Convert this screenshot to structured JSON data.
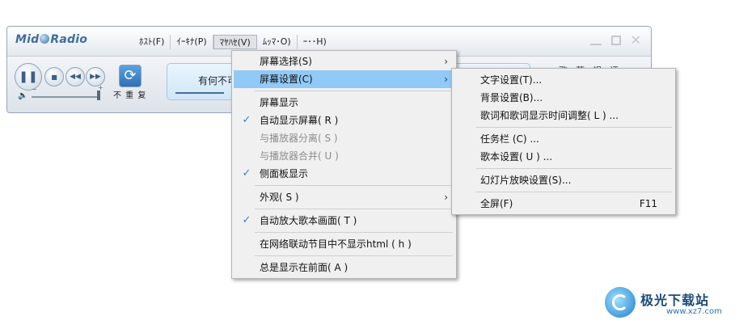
{
  "app": {
    "logo": "MidRadio",
    "menubar": [
      "ﾎｽﾄ(F)",
      "ｲｰｷﾅ(P)",
      "ﾏﾔﾊｾ(V)",
      "ﾑｯﾏ･O)",
      "ｰ･･H)"
    ],
    "window_buttons": [
      "minimize-icon",
      "maximize-icon",
      "close-icon"
    ]
  },
  "player": {
    "song": "有何不可",
    "repeat_label": "不 重 复",
    "side_labels": [
      "歌",
      "蒂",
      "视",
      "评"
    ]
  },
  "menu_main": {
    "items": [
      {
        "label": "屏幕选择(S)",
        "submenu": true,
        "checked": false,
        "disabled": false,
        "highlight": false
      },
      {
        "label": "屏幕设置(C)",
        "submenu": true,
        "checked": false,
        "disabled": false,
        "highlight": true
      },
      {
        "label": "屏幕显示",
        "submenu": false,
        "checked": false,
        "disabled": false,
        "highlight": false
      },
      {
        "label": "自动显示屏幕( R )",
        "submenu": false,
        "checked": true,
        "disabled": false,
        "highlight": false
      },
      {
        "label": "与播放器分离( S )",
        "submenu": false,
        "checked": false,
        "disabled": true,
        "highlight": false
      },
      {
        "label": "与播放器合并( U )",
        "submenu": false,
        "checked": false,
        "disabled": true,
        "highlight": false
      },
      {
        "label": "侧面板显示",
        "submenu": false,
        "checked": true,
        "disabled": false,
        "highlight": false
      },
      {
        "label": "外观( S )",
        "submenu": true,
        "checked": false,
        "disabled": false,
        "highlight": false
      },
      {
        "label": "自动放大歌本画面( T )",
        "submenu": false,
        "checked": true,
        "disabled": false,
        "highlight": false
      },
      {
        "label": "在网络联动节目中不显示html ( h )",
        "submenu": false,
        "checked": false,
        "disabled": false,
        "highlight": false
      },
      {
        "label": "总是显示在前面( A )",
        "submenu": false,
        "checked": false,
        "disabled": false,
        "highlight": false
      }
    ]
  },
  "menu_sub": {
    "items": [
      {
        "label": "文字设置(T)...",
        "shortcut": ""
      },
      {
        "label": "背景设置(B)...",
        "shortcut": ""
      },
      {
        "label": "歌词和歌词显示时间调整( L ) ...",
        "shortcut": ""
      },
      {
        "label": "任务栏 (C) ...",
        "shortcut": ""
      },
      {
        "label": "歌本设置( U ) ...",
        "shortcut": ""
      },
      {
        "label": "幻灯片放映设置(S)...",
        "shortcut": ""
      },
      {
        "label": "全屏(F)",
        "shortcut": "F11"
      }
    ]
  },
  "watermark": {
    "title": "极光下载站",
    "url": "www.xz7.com"
  }
}
